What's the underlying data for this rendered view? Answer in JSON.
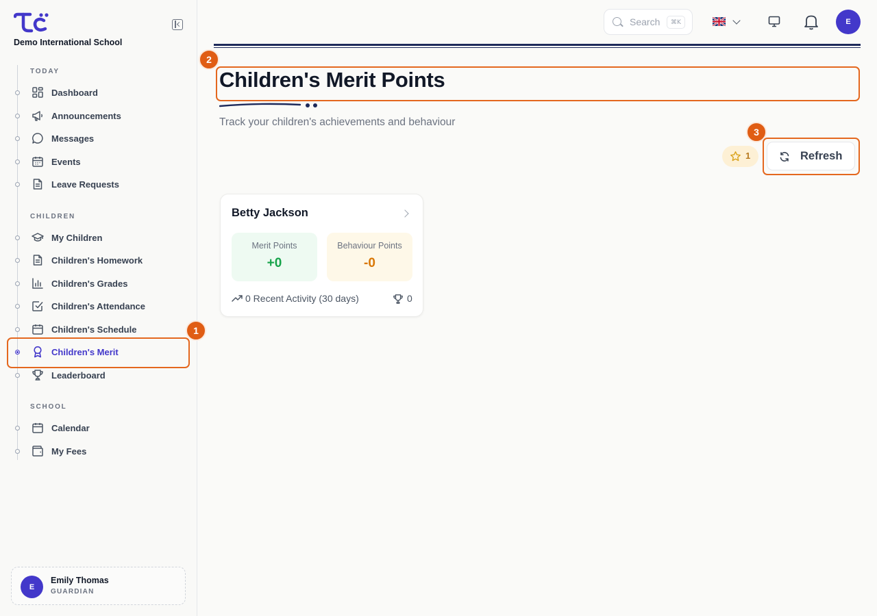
{
  "school": {
    "name": "Demo International School"
  },
  "nav": {
    "sections": [
      {
        "label": "TODAY"
      },
      {
        "label": "CHILDREN"
      },
      {
        "label": "SCHOOL"
      }
    ],
    "items": [
      {
        "label": "Dashboard",
        "icon": "grid-icon"
      },
      {
        "label": "Announcements",
        "icon": "megaphone-icon"
      },
      {
        "label": "Messages",
        "icon": "chat-icon"
      },
      {
        "label": "Events",
        "icon": "calendar-icon"
      },
      {
        "label": "Leave Requests",
        "icon": "document-icon"
      },
      {
        "label": "My Children",
        "icon": "graduation-cap-icon"
      },
      {
        "label": "Children's Homework",
        "icon": "document-icon"
      },
      {
        "label": "Children's Grades",
        "icon": "bar-chart-icon"
      },
      {
        "label": "Children's Attendance",
        "icon": "checkbox-icon"
      },
      {
        "label": "Children's Schedule",
        "icon": "calendar-icon"
      },
      {
        "label": "Children's Merit",
        "icon": "award-icon",
        "active": true
      },
      {
        "label": "Leaderboard",
        "icon": "trophy-icon"
      },
      {
        "label": "Calendar",
        "icon": "calendar-icon"
      },
      {
        "label": "My Fees",
        "icon": "wallet-icon"
      }
    ]
  },
  "user": {
    "initial": "E",
    "name": "Emily Thomas",
    "role": "GUARDIAN"
  },
  "topbar": {
    "search_placeholder": "Search",
    "search_shortcut": "⌘K",
    "avatar_initial": "E"
  },
  "page": {
    "title": "Children's Merit Points",
    "subtitle": "Track your children's achievements and behaviour",
    "star_count": "1",
    "refresh_label": "Refresh"
  },
  "annotations": [
    "1",
    "2",
    "3"
  ],
  "children": [
    {
      "name": "Betty Jackson",
      "merit_label": "Merit Points",
      "merit_value": "+0",
      "behaviour_label": "Behaviour Points",
      "behaviour_value": "-0",
      "activity": "0 Recent Activity (30 days)",
      "trophies": "0"
    }
  ],
  "colors": {
    "primary": "#4338ca",
    "annotation": "#e05d14",
    "merit": "#16a34a",
    "behaviour": "#d97706"
  }
}
